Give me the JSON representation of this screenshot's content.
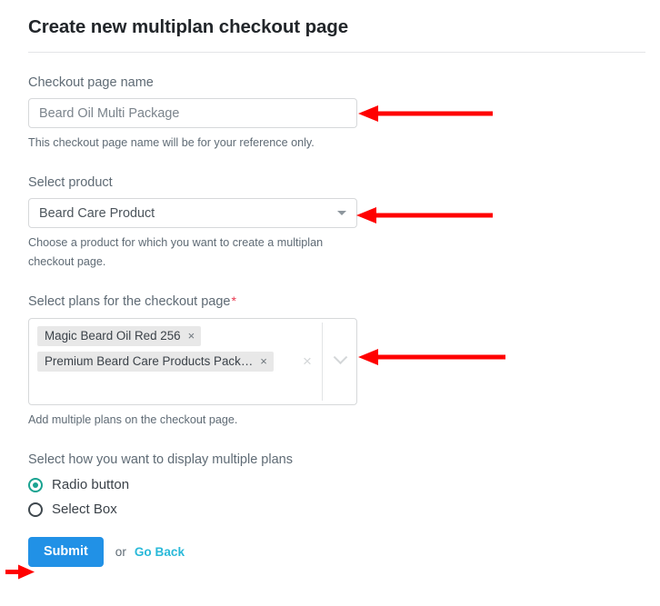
{
  "header": {
    "title": "Create new multiplan checkout page"
  },
  "form": {
    "checkout_name": {
      "label": "Checkout page name",
      "value": "Beard Oil Multi Package",
      "placeholder": "Beard Oil Multi Package",
      "help": "This checkout page name will be for your reference only."
    },
    "product": {
      "label": "Select product",
      "selected": "Beard Care Product",
      "help": "Choose a product for which you want to create a multiplan checkout page.",
      "caret_icon": "caret-down-icon"
    },
    "plans": {
      "label": "Select plans for the checkout page",
      "required_marker": "*",
      "help": "Add multiple plans on the checkout page.",
      "tags": [
        {
          "label": "Magic Beard Oil Red 256",
          "remove_icon": "×"
        },
        {
          "label": "Premium Beard Care Products Pack…",
          "remove_icon": "×"
        }
      ],
      "clear_all_icon": "×",
      "dropdown_icon": "chevron-down-icon"
    },
    "display_mode": {
      "label": "Select how you want to display multiple plans",
      "options": [
        {
          "label": "Radio button",
          "checked": true
        },
        {
          "label": "Select Box",
          "checked": false
        }
      ]
    }
  },
  "footer": {
    "submit_label": "Submit",
    "or_label": "or",
    "go_back_label": "Go Back"
  },
  "colors": {
    "accent_blue": "#2191e6",
    "link_cyan": "#2ab9d9",
    "radio_teal": "#1aa391",
    "required_red": "#e8384f",
    "annotation_red": "#ff0000",
    "label_gray": "#5f6b75",
    "border_gray": "#d6d8da",
    "tag_bg": "#e8e8e8"
  },
  "annotations": [
    {
      "name": "arrow-to-checkout-name-input",
      "direction": "left"
    },
    {
      "name": "arrow-to-product-select",
      "direction": "left"
    },
    {
      "name": "arrow-to-plans-multiselect",
      "direction": "left"
    },
    {
      "name": "arrow-to-submit-button",
      "direction": "right"
    }
  ]
}
